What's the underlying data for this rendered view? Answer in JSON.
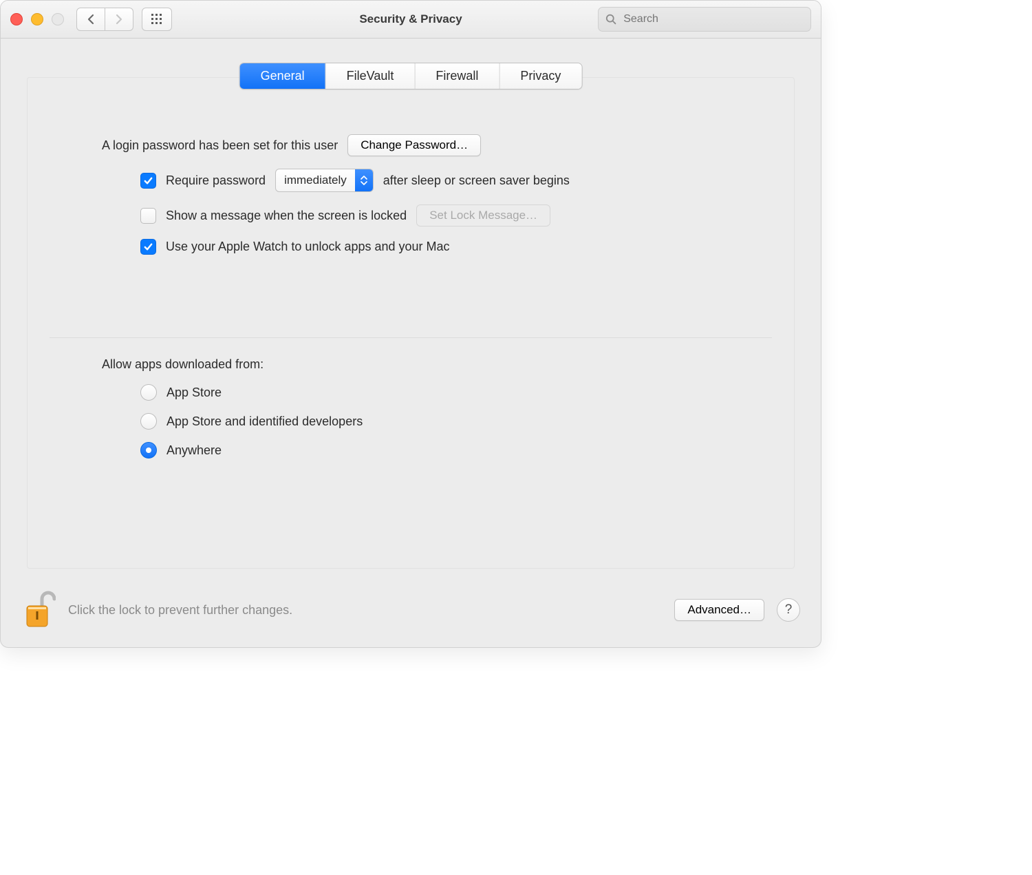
{
  "window": {
    "title": "Security & Privacy"
  },
  "search": {
    "placeholder": "Search"
  },
  "tabs": [
    {
      "label": "General",
      "selected": true
    },
    {
      "label": "FileVault",
      "selected": false
    },
    {
      "label": "Firewall",
      "selected": false
    },
    {
      "label": "Privacy",
      "selected": false
    }
  ],
  "login": {
    "intro": "A login password has been set for this user",
    "change_button": "Change Password…",
    "require_label_before": "Require password",
    "require_popup_value": "immediately",
    "require_label_after": "after sleep or screen saver begins",
    "show_message_label": "Show a message when the screen is locked",
    "set_lock_message_button": "Set Lock Message…",
    "apple_watch_label": "Use your Apple Watch to unlock apps and your Mac"
  },
  "gatekeeper": {
    "heading": "Allow apps downloaded from:",
    "options": [
      {
        "label": "App Store",
        "selected": false
      },
      {
        "label": "App Store and identified developers",
        "selected": false
      },
      {
        "label": "Anywhere",
        "selected": true
      }
    ]
  },
  "footer": {
    "lock_hint": "Click the lock to prevent further changes.",
    "advanced_button": "Advanced…",
    "help_symbol": "?"
  }
}
